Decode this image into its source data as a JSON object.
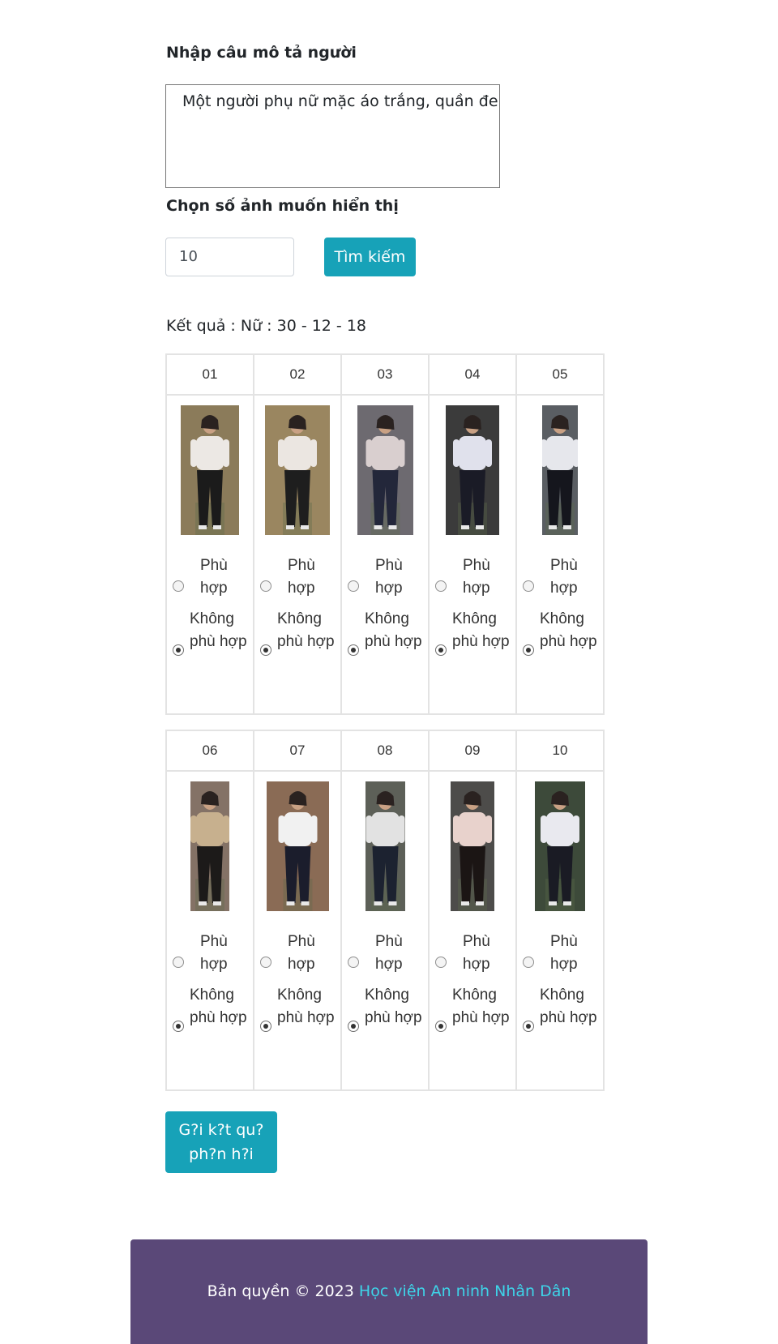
{
  "form": {
    "description_label": "Nhập câu mô tả người",
    "description_value": "Một người phụ nữ mặc áo trắng, quần đen",
    "count_label": "Chọn số ảnh muốn hiển thị",
    "count_value": "10",
    "search_button": "Tìm kiếm"
  },
  "result": {
    "summary": "Kết quả : Nữ : 30 - 12 - 18"
  },
  "options": {
    "match_label": "Phù hợp",
    "no_match_label": "Không phù hợp"
  },
  "results": [
    {
      "index": "01",
      "icon": "person-photo",
      "shirt": "#ece8e4",
      "pants": "#1b1b1b",
      "bg": "#8b7b5a",
      "selected": "no_match"
    },
    {
      "index": "02",
      "icon": "person-photo",
      "shirt": "#ebe6e1",
      "pants": "#1e1e1e",
      "bg": "#9a8660",
      "selected": "no_match"
    },
    {
      "index": "03",
      "icon": "person-photo",
      "shirt": "#d9cfcf",
      "pants": "#23273a",
      "bg": "#6d6a70",
      "selected": "no_match"
    },
    {
      "index": "04",
      "icon": "person-photo",
      "shirt": "#e0e1ec",
      "pants": "#1a1b26",
      "bg": "#3b3b3b",
      "selected": "no_match"
    },
    {
      "index": "05",
      "icon": "person-photo",
      "shirt": "#e6e7ec",
      "pants": "#15161d",
      "bg": "#5a5e63",
      "selected": "no_match"
    },
    {
      "index": "06",
      "icon": "person-photo",
      "shirt": "#c7b08e",
      "pants": "#1c1a19",
      "bg": "#847266",
      "selected": "no_match"
    },
    {
      "index": "07",
      "icon": "person-photo",
      "shirt": "#f1f1f1",
      "pants": "#1b1d2c",
      "bg": "#8a6b55",
      "selected": "no_match"
    },
    {
      "index": "08",
      "icon": "person-photo",
      "shirt": "#e2e2e2",
      "pants": "#1c2230",
      "bg": "#5d6058",
      "selected": "no_match"
    },
    {
      "index": "09",
      "icon": "person-photo",
      "shirt": "#e8d2cc",
      "pants": "#1b1514",
      "bg": "#4d4c4a",
      "selected": "no_match"
    },
    {
      "index": "10",
      "icon": "person-photo",
      "shirt": "#e9e9ef",
      "pants": "#1a1b24",
      "bg": "#3d4a3a",
      "selected": "no_match"
    }
  ],
  "submit_button": "G?i k?t qu? ph?n h?i",
  "footer": {
    "copyright": "Bản quyền © 2023",
    "organization": "Học viện An ninh Nhân Dân"
  },
  "colors": {
    "accent": "#17a2b8",
    "footer_bg": "#5a4878",
    "footer_link": "#3ed4e8"
  }
}
